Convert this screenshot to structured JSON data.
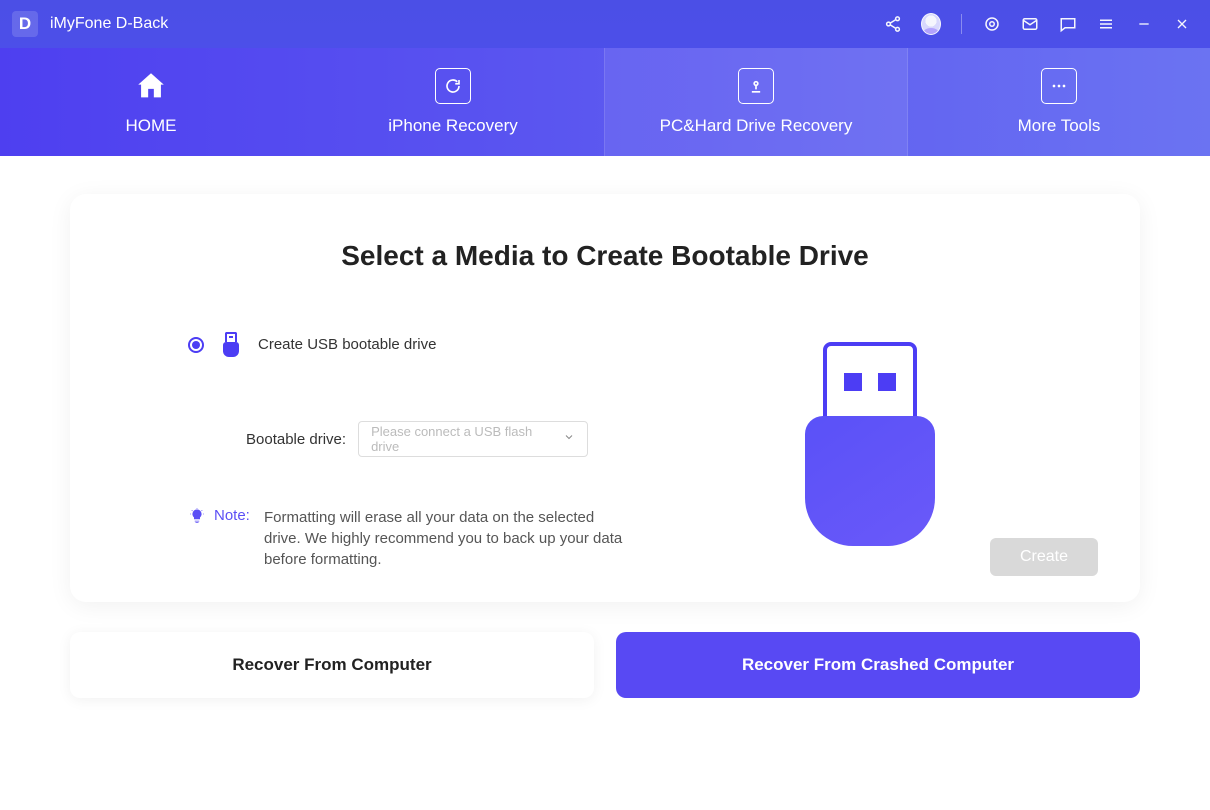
{
  "app": {
    "logo_letter": "D",
    "title": "iMyFone D-Back"
  },
  "nav": {
    "home": "HOME",
    "iphone": "iPhone Recovery",
    "pc": "PC&Hard Drive Recovery",
    "more": "More Tools"
  },
  "main": {
    "title": "Select a Media to Create Bootable Drive",
    "radio_label": "Create USB bootable drive",
    "field_label": "Bootable drive:",
    "select_placeholder": "Please connect a USB flash drive",
    "note_label": "Note:",
    "note_text": "Formatting will erase all your data on the selected drive. We highly recommend you to back up your data before formatting.",
    "create_button": "Create"
  },
  "bottom": {
    "recover_computer": "Recover From Computer",
    "recover_crashed": "Recover From Crashed Computer"
  }
}
